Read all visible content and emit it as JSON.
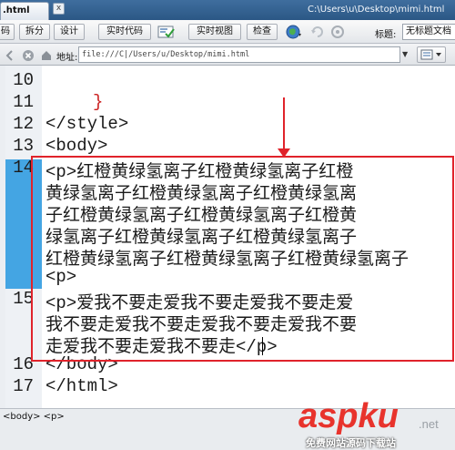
{
  "titlebar": {
    "tab_label": ".html",
    "close_glyph": "x",
    "path": "C:\\Users\\u\\Desktop\\mimi.html"
  },
  "toolbar": {
    "code_label": "码",
    "split_label": "拆分",
    "design_label": "设计",
    "live_code_label": "实时代码",
    "live_view_label": "实时视图",
    "inspect_label": "检查",
    "title_label": "标题:",
    "title_value": "无标题文档"
  },
  "addressbar": {
    "label": "地址:",
    "url": "file:///C|/Users/u/Desktop/mimi.html",
    "dropdown_glyph": "▼"
  },
  "editor": {
    "lines": [
      {
        "num": "10",
        "text": ""
      },
      {
        "num": "11",
        "text": "}"
      },
      {
        "num": "12",
        "text": "</style>"
      },
      {
        "num": "13",
        "text": "<body>"
      },
      {
        "num": "14",
        "text": "<p>红橙黄绿氢离子红橙黄绿氢离子红橙"
      },
      {
        "num": "",
        "text": "黄绿氢离子红橙黄绿氢离子红橙黄绿氢离"
      },
      {
        "num": "",
        "text": "子红橙黄绿氢离子红橙黄绿氢离子红橙黄"
      },
      {
        "num": "",
        "text": "绿氢离子红橙黄绿氢离子红橙黄绿氢离子"
      },
      {
        "num": "",
        "text": "红橙黄绿氢离子红橙黄绿氢离子红橙黄绿氢离子"
      },
      {
        "num": "",
        "text": "<p>"
      },
      {
        "num": "15",
        "text": "<p>爱我不要走爱我不要走爱我不要走爱"
      },
      {
        "num": "",
        "text": "我不要走爱我不要走爱我不要走爱我不要"
      },
      {
        "num": "",
        "text": "走爱我不要走爱我不要走</p>"
      },
      {
        "num": "16",
        "text": "</body>"
      },
      {
        "num": "17",
        "text": "</html>"
      }
    ]
  },
  "statusbar": {
    "tag_selector": "<body> <p>"
  },
  "watermark": {
    "brand": "aspku",
    "tld": ".net",
    "slogan": "免费网站源码下载站"
  },
  "colors": {
    "annotation_red": "#e0232b",
    "active_line_blue": "#44a5e3"
  },
  "icons": [
    "arrow-left-icon",
    "close-icon",
    "home-icon",
    "globe-icon",
    "validate-icon",
    "options-icon"
  ]
}
